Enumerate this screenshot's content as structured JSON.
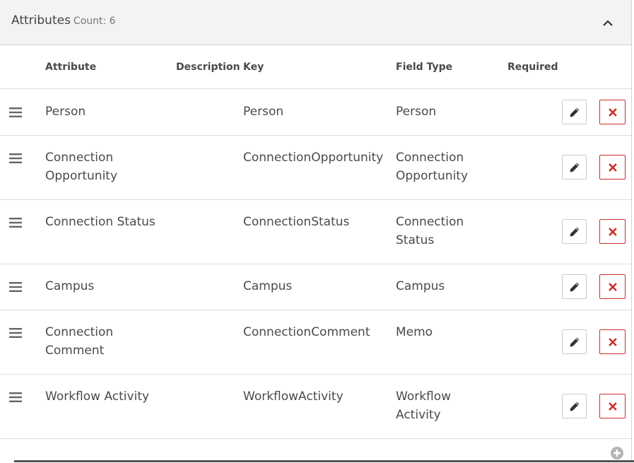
{
  "panel": {
    "title": "Attributes",
    "count_label": "Count: 6",
    "collapse_icon": "chevron-up-icon"
  },
  "table": {
    "headers": {
      "attribute": "Attribute",
      "description": "Description",
      "key": "Key",
      "field_type": "Field Type",
      "required": "Required"
    },
    "rows": [
      {
        "attribute": [
          "Person"
        ],
        "description": "",
        "key": "Person",
        "field_type": [
          "Person"
        ]
      },
      {
        "attribute": [
          "Connection",
          "Opportunity"
        ],
        "description": "",
        "key": "ConnectionOpportunity",
        "field_type": [
          "Connection",
          "Opportunity"
        ]
      },
      {
        "attribute": [
          "Connection Status"
        ],
        "description": "",
        "key": "ConnectionStatus",
        "field_type": [
          "Connection",
          "Status"
        ]
      },
      {
        "attribute": [
          "Campus"
        ],
        "description": "",
        "key": "Campus",
        "field_type": [
          "Campus"
        ]
      },
      {
        "attribute": [
          "Connection",
          "Comment"
        ],
        "description": "",
        "key": "ConnectionComment",
        "field_type": [
          "Memo"
        ]
      },
      {
        "attribute": [
          "Workflow Activity"
        ],
        "description": "",
        "key": "WorkflowActivity",
        "field_type": [
          "Workflow",
          "Activity"
        ]
      }
    ]
  },
  "icons": {
    "drag": "drag-handle-icon",
    "edit": "pencil-icon",
    "delete": "close-icon",
    "add": "plus-circle-icon"
  },
  "colors": {
    "header_bg": "#f3f3f3",
    "text": "#4a4a4a",
    "danger": "#c9302c"
  }
}
